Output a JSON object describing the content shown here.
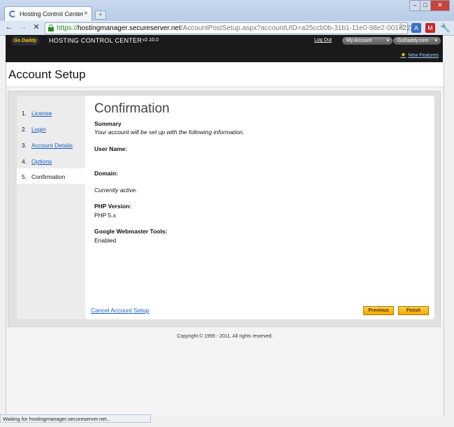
{
  "browser": {
    "tab_title": "Hosting Control Center",
    "tab_close": "×",
    "new_tab": "+",
    "url_scheme": "https://",
    "url_host": "hostingmanager.secureserver.net",
    "url_path": "/AccountPostSetup.aspx?accountUID=a25ccb0b-31b1-11e0-98e2-001422211",
    "back_icon": "←",
    "forward_icon": "→",
    "stop_icon": "✕",
    "star_icon": "☆",
    "wrench_icon": "🔧",
    "ext_translate_label": "A",
    "ext_mail_label": "M",
    "status_text": "Waiting for hostingmanager.secureserver.net..."
  },
  "header": {
    "logo_text": "Go Daddy",
    "title": "HOSTING CONTROL CENTER",
    "version": "v2.10.0",
    "logout": "Log Out",
    "my_account": "My Account",
    "godaddy_com": "GoDaddy.com",
    "dropdown_caret": "▾",
    "new_features": "New Features"
  },
  "page": {
    "title": "Account Setup",
    "steps": [
      {
        "num": "1.",
        "label": "License",
        "active": false
      },
      {
        "num": "2.",
        "label": "Login",
        "active": false
      },
      {
        "num": "3.",
        "label": "Account Details",
        "active": false
      },
      {
        "num": "4.",
        "label": "Options",
        "active": false
      },
      {
        "num": "5.",
        "label": "Confirmation",
        "active": true
      }
    ],
    "confirmation": {
      "heading": "Confirmation",
      "summary_label": "Summary",
      "summary_text": "Your account will be set up with the following information.",
      "user_name_label": "User Name:",
      "domain_label": "Domain:",
      "domain_status": "Currently active.",
      "php_label": "PHP Version:",
      "php_value": "PHP 5.x",
      "gwt_label": "Google Webmaster Tools:",
      "gwt_value": "Enabled"
    },
    "cancel": "Cancel Account Setup",
    "previous": "Previous",
    "finish": "Finish",
    "copyright": "Copyright © 1999 - 2011, All rights reserved."
  },
  "colors": {
    "link": "#1a5fc2",
    "header_bg": "#1a1a1a",
    "button_yellow": "#f0a800",
    "https_green": "#1a8a1a"
  }
}
